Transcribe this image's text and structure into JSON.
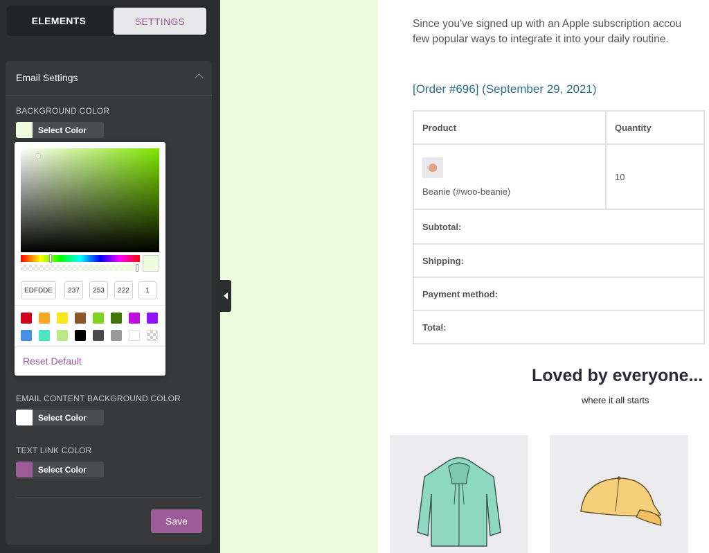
{
  "sidebar": {
    "tabs": [
      {
        "label": "ELEMENTS",
        "active": false
      },
      {
        "label": "SETTINGS",
        "active": true
      }
    ],
    "panel": {
      "title": "Email Settings",
      "fields": [
        {
          "label": "BACKGROUND COLOR",
          "button_label": "Select Color",
          "color": "#edfdde"
        },
        {
          "label": "EMAIL CONTENT BACKGROUND COLOR",
          "button_label": "Select Color",
          "color": "#ffffff"
        },
        {
          "label": "TEXT LINK COLOR",
          "button_label": "Select Color",
          "color": "#9b5b96"
        }
      ],
      "save_label": "Save"
    },
    "accent_color": "#9b5b96"
  },
  "color_picker": {
    "hex": "EDFDDE",
    "r": "237",
    "g": "253",
    "b": "222",
    "a": "1",
    "presets": [
      "#d0021b",
      "#f5a623",
      "#f8e71c",
      "#8b572a",
      "#7ed321",
      "#417505",
      "#bd10e0",
      "#9013fe",
      "#4a90e2",
      "#50e3c2",
      "#b8e986",
      "#000000",
      "#4a4a4a",
      "#9b9b9b",
      "#ffffff",
      "transparent"
    ],
    "reset_label": "Reset Default"
  },
  "email": {
    "intro_line1": "Since you've signed up with an Apple subscription accou",
    "intro_line2": "few popular ways to integrate it into your daily routine.",
    "order_link": "[Order #696] (September 29, 2021)",
    "table": {
      "headers": [
        "Product",
        "Quantity"
      ],
      "item": {
        "name": "Beanie (#woo-beanie)",
        "quantity": "10"
      },
      "totals": [
        "Subtotal:",
        "Shipping:",
        "Payment method:",
        "Total:"
      ]
    },
    "section_title": "Loved by everyone...",
    "section_subtitle": "where it all starts",
    "products": [
      {
        "icon": "hoodie-image"
      },
      {
        "icon": "cap-image"
      }
    ]
  }
}
